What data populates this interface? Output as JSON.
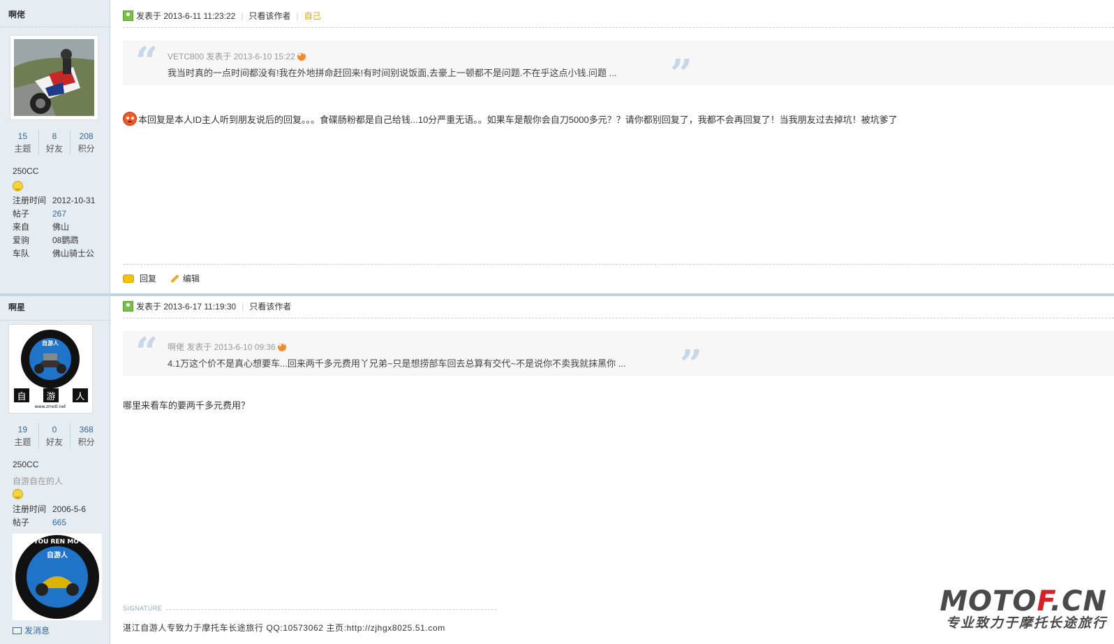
{
  "posts": [
    {
      "username": "啊佬",
      "stats": [
        {
          "num": "15",
          "label": "主题"
        },
        {
          "num": "8",
          "label": "好友"
        },
        {
          "num": "208",
          "label": "积分"
        }
      ],
      "group": "250CC",
      "info": [
        {
          "k": "注册时间",
          "v": "2012-10-31"
        },
        {
          "k": "帖子",
          "v": "267"
        },
        {
          "k": "来自",
          "v": "佛山"
        },
        {
          "k": "爱驹",
          "v": "08鹦鹉"
        },
        {
          "k": "车队",
          "v": "佛山骑士公"
        }
      ],
      "meta": {
        "posted": "发表于 2013-6-11 11:23:22",
        "only_author": "只看该作者",
        "self": "自己"
      },
      "quote": {
        "author": "VETC800 发表于 2013-6-10 15:22",
        "text": "我当时真的一点时间都没有!我在外地拼命赶回来!有时间别说饭面,去豪上一顿都不是问题.不在乎这点小钱.问题 ..."
      },
      "content": "本回复是本人ID主人听到朋友说后的回复。。。食碟肠粉都是自己给钱...10分严重无语。。如果车是靓你会自刀5000多元？？请你都别回复了，我都不会再回复了！当我朋友过去掉坑！被坑爹了",
      "actions": {
        "reply": "回复",
        "edit": "编辑"
      }
    },
    {
      "username": "啊星",
      "stats": [
        {
          "num": "19",
          "label": "主题"
        },
        {
          "num": "0",
          "label": "好友"
        },
        {
          "num": "368",
          "label": "积分"
        }
      ],
      "group": "250CC",
      "title": "自游自在的人",
      "info": [
        {
          "k": "注册时间",
          "v": "2006-5-6"
        },
        {
          "k": "帖子",
          "v": "665"
        }
      ],
      "meta": {
        "posted": "发表于 2013-6-17 11:19:30",
        "only_author": "只看该作者"
      },
      "quote": {
        "author": "啊佬 发表于 2013-6-10 09:36",
        "text": "4.1万这个价不是真心想要车...回来两千多元费用丫兄弟~只是想捞部车回去总算有交代~不是说你不卖我就抹黑你 ..."
      },
      "content": "哪里来看车的要两千多元费用？",
      "signature_label": "SIGNATURE",
      "signature": "湛江自游人专致力于摩托车长途旅行 QQ:10573062 主页:http://zjhgx8025.51.com",
      "send_message": "发消息",
      "logo": {
        "ring_text": "ZI YOU REN MO LU",
        "center_text": "自游人",
        "bottom_chars": [
          "自",
          "游",
          "人"
        ],
        "url": "www.zmotl.net"
      }
    }
  ],
  "watermark": {
    "main_a": "MOTO",
    "main_b": "F",
    "main_c": ".CN",
    "sub": "专业致力于摩托长途旅行"
  },
  "colors": {
    "sidebar_bg": "#e5edf2",
    "link": "#336699",
    "self_tag": "#d9a300",
    "watermark_red": "#d3232a"
  }
}
